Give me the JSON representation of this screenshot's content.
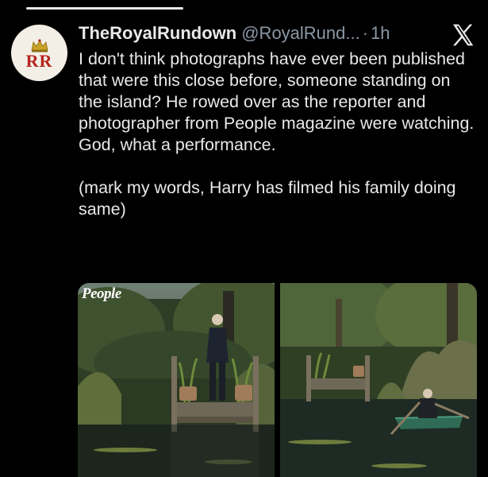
{
  "tweet": {
    "author_name": "TheRoyalRundown",
    "handle": "@RoyalRund...",
    "separator": "·",
    "time": "1h",
    "avatar_monogram": "RR",
    "text": "I don't think photographs have ever been published that were this close before, someone standing on the island? He rowed over as the reporter and photographer from People magazine were watching. God, what a performance.\n\n(mark my words, Harry has filmed his family doing same)"
  },
  "media": {
    "photos": [
      {
        "watermark": "People",
        "description_icon": "man-standing-on-jetty"
      },
      {
        "description_icon": "man-rowing-boat"
      }
    ]
  },
  "icons": {
    "platform_logo": "x-logo-icon",
    "avatar_crown": "crown-icon"
  },
  "colors": {
    "background": "#000000",
    "text_primary": "#e7e9ea",
    "text_secondary": "#8b98a5",
    "avatar_accent": "#b3261e"
  }
}
